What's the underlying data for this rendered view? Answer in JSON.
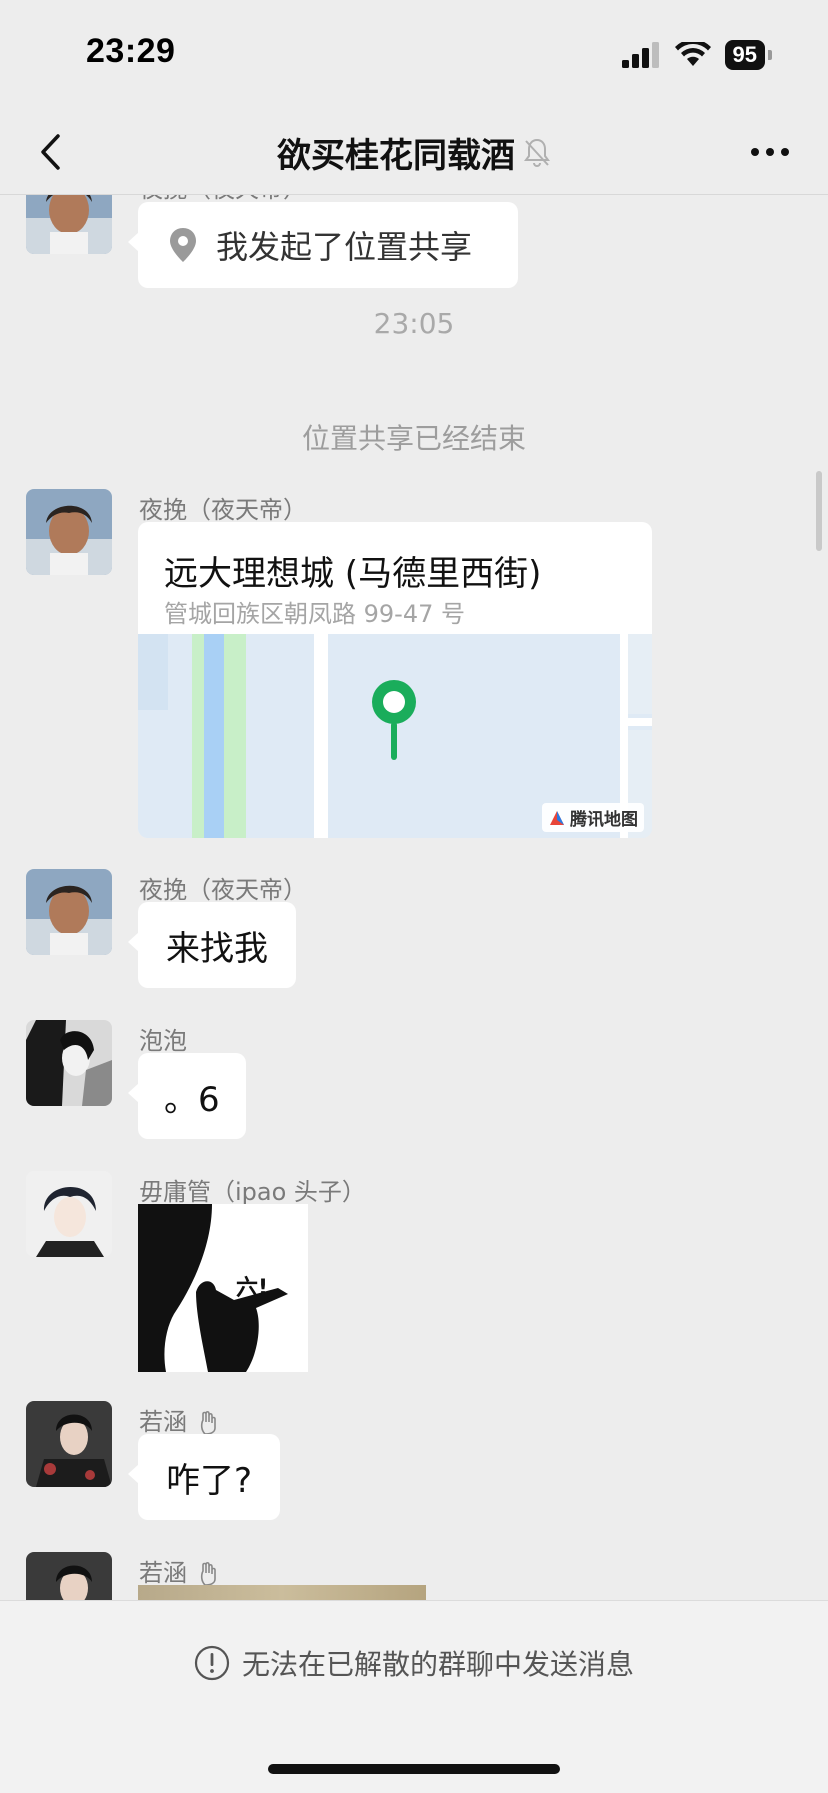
{
  "status": {
    "time": "23:29",
    "battery": "95"
  },
  "nav": {
    "title": "欲买桂花同载酒",
    "title_icon": "bell-muted-icon",
    "back_icon": "chevron-left-icon",
    "more_icon": "more-dots-icon"
  },
  "messages": {
    "m1": {
      "sender": "夜挽（夜天帝）",
      "text": "我发起了位置共享",
      "icon": "location-pin-icon"
    },
    "time1": "23:05",
    "system1": "位置共享已经结束",
    "m2": {
      "sender": "夜挽（夜天帝）",
      "title": "远大理想城 (马德里西街)",
      "address": "管城回族区朝凤路 99-47 号",
      "map_credit": "腾讯地图"
    },
    "m3": {
      "sender": "夜挽（夜天帝）",
      "text": "来找我"
    },
    "m4": {
      "sender": "泡泡",
      "text": "。6"
    },
    "m5": {
      "sender": "毋庸管（ipao 头子）",
      "sticker_text": "六!"
    },
    "m6": {
      "sender": "若涵",
      "text": "咋了?"
    },
    "m7": {
      "sender": "若涵"
    }
  },
  "footer": {
    "disabled_text": "无法在已解散的群聊中发送消息",
    "icon": "alert-circle-icon"
  },
  "colors": {
    "background": "#ededed",
    "bubble": "#ffffff",
    "map_pin": "#1aad5b",
    "map_water": "#dfeaf5",
    "map_green": "#c8efc8",
    "map_river": "#a9d0f5"
  }
}
